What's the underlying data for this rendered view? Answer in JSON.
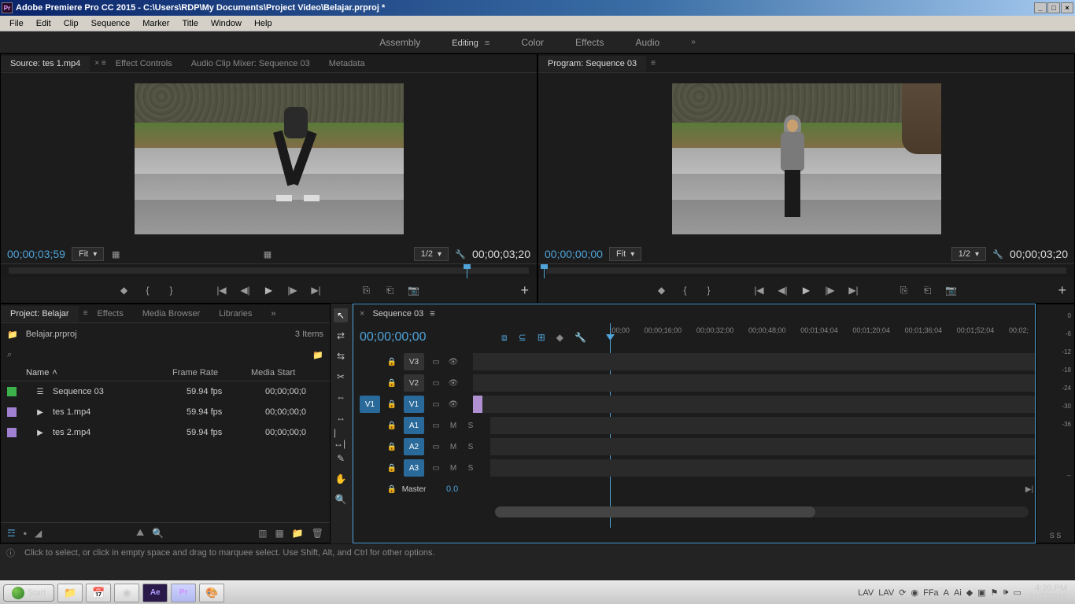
{
  "window": {
    "app_badge": "Pr",
    "title": "Adobe Premiere Pro CC 2015 - C:\\Users\\RDP\\My Documents\\Project Video\\Belajar.prproj *",
    "btn_min": "_",
    "btn_max": "□",
    "btn_close": "×"
  },
  "menubar": [
    "File",
    "Edit",
    "Clip",
    "Sequence",
    "Marker",
    "Title",
    "Window",
    "Help"
  ],
  "workspaces": {
    "items": [
      "Assembly",
      "Editing",
      "Color",
      "Effects",
      "Audio"
    ],
    "active_index": 1,
    "menu_glyph": "≡",
    "overflow": "»"
  },
  "source_panel": {
    "tabs": [
      "Source: tes 1.mp4",
      "Effect Controls",
      "Audio Clip Mixer: Sequence 03",
      "Metadata"
    ],
    "active_tab": 0,
    "timecode_left": "00;00;03;59",
    "zoom_label": "Fit",
    "res_label": "1/2",
    "timecode_right": "00;00;03;20",
    "playhead_pct": 87
  },
  "program_panel": {
    "tab": "Program: Sequence 03",
    "timecode_left": "00;00;00;00",
    "zoom_label": "Fit",
    "res_label": "1/2",
    "timecode_right": "00;00;03;20",
    "playhead_pct": 0
  },
  "project_panel": {
    "tabs": [
      "Project: Belajar",
      "Effects",
      "Media Browser",
      "Libraries"
    ],
    "active_tab": 0,
    "bin_name": "Belajar.prproj",
    "item_count": "3 Items",
    "columns": {
      "name": "Name",
      "frame": "Frame Rate",
      "start": "Media Start"
    },
    "rows": [
      {
        "color": "#3cb04a",
        "icon": "seq",
        "name": "Sequence 03",
        "frame": "59.94 fps",
        "start": "00;00;00;0"
      },
      {
        "color": "#a080d0",
        "icon": "vid",
        "name": "tes 1.mp4",
        "frame": "59.94 fps",
        "start": "00;00;00;0"
      },
      {
        "color": "#a080d0",
        "icon": "vid",
        "name": "tes 2.mp4",
        "frame": "59.94 fps",
        "start": "00;00;00;0"
      }
    ],
    "overflow": "»"
  },
  "timeline": {
    "tab": "Sequence 03",
    "timecode": "00;00;00;00",
    "ruler_marks": [
      ";00;00",
      "00;00;16;00",
      "00;00;32;00",
      "00;00;48;00",
      "00;01;04;04",
      "00;01;20;04",
      "00;01;36;04",
      "00;01;52;04",
      "00;02;"
    ],
    "video_tracks": [
      {
        "src": "",
        "tgt": "V3",
        "on": false
      },
      {
        "src": "",
        "tgt": "V2",
        "on": false
      },
      {
        "src": "V1",
        "tgt": "V1",
        "on": true,
        "has_clip": true
      }
    ],
    "audio_tracks": [
      {
        "src": "",
        "tgt": "A1",
        "on": true
      },
      {
        "src": "",
        "tgt": "A2",
        "on": true
      },
      {
        "src": "",
        "tgt": "A3",
        "on": true
      }
    ],
    "master": {
      "label": "Master",
      "value": "0.0"
    }
  },
  "meters": {
    "scale": [
      "0",
      "-6",
      "-12",
      "-18",
      "-24",
      "-30",
      "-36",
      "",
      "",
      "",
      "--"
    ],
    "channels": "S  S"
  },
  "statusbar": {
    "hint": "Click to select, or click in empty space and drag to marquee select. Use Shift, Alt, and Ctrl for other options."
  },
  "taskbar": {
    "start": "Start",
    "tray_icons": [
      "LAV",
      "LAV",
      "⟳",
      "◉",
      "FFa",
      "A",
      "Ai",
      "◆",
      "▣",
      "⚑",
      "🕪",
      "▭"
    ],
    "time": "4:20 PM",
    "date": "11/7/2016"
  },
  "transport_icons": {
    "marker_add": "◆",
    "in": "{",
    "out": "}",
    "goto_in": "|◀",
    "step_back": "◀|",
    "play": "▶",
    "step_fwd": "|▶",
    "goto_out": "▶|",
    "lift": "⎘",
    "extract": "⎗",
    "export": "📷",
    "plus": "+",
    "wrench": "🔧",
    "safe": "▦",
    "settings": "⚙"
  },
  "tools": [
    "↖",
    "⇄",
    "⇆",
    "✂",
    "⇔",
    "↔",
    "|↔|",
    "✎",
    "✋",
    "🔍"
  ]
}
